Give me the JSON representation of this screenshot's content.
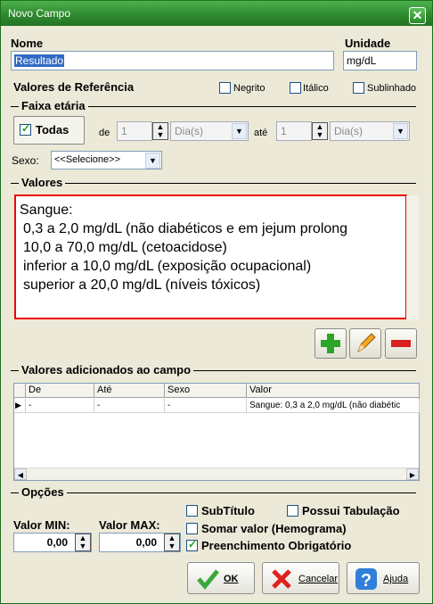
{
  "window": {
    "title": "Novo Campo",
    "close": "✕"
  },
  "fields": {
    "nome_label": "Nome",
    "nome_value": "Resultado",
    "unidade_label": "Unidade",
    "unidade_value": "mg/dL"
  },
  "ref": {
    "label": "Valores de Referência",
    "negrito": "Negrito",
    "italico": "Itálico",
    "sublinhado": "Sublinhado"
  },
  "faixa": {
    "label": "Faixa etária",
    "todas": "Todas",
    "todas_checked": true,
    "de": "de",
    "de_value": "1",
    "de_unit": "Dia(s)",
    "ate": "até",
    "ate_value": "1",
    "ate_unit": "Dia(s)"
  },
  "sexo": {
    "label": "Sexo:",
    "value": "<<Selecione>>"
  },
  "valores": {
    "label": "Valores",
    "lines": [
      "Sangue:",
      "0,3 a 2,0 mg/dL (não diabéticos e em jejum prolong",
      "10,0 a 70,0 mg/dL (cetoacidose)",
      "inferior a 10,0 mg/dL (exposição ocupacional)",
      "superior a 20,0 mg/dL (níveis tóxicos)"
    ]
  },
  "adicionados": {
    "label": "Valores adicionados ao campo",
    "columns": [
      "De",
      "Até",
      "Sexo",
      "Valor"
    ],
    "rows": [
      [
        "-",
        "-",
        "-",
        "Sangue: 0,3 a 2,0 mg/dL (não diabétic"
      ]
    ]
  },
  "opcoes": {
    "label": "Opções",
    "min_label": "Valor MIN:",
    "min_value": "0,00",
    "max_label": "Valor MAX:",
    "max_value": "0,00",
    "subtitulo": "SubTítulo",
    "somar": "Somar valor (Hemograma)",
    "tabulacao": "Possui Tabulação",
    "obrigatorio": "Preenchimento Obrigatório",
    "obrigatorio_checked": true
  },
  "buttons": {
    "ok": "OK",
    "cancelar": "Cancelar",
    "ajuda": "Ajuda"
  },
  "colors": {
    "title": "#2f8a2f",
    "memo_border": "#e00000",
    "add": "#2aa52a",
    "remove": "#d82020"
  }
}
